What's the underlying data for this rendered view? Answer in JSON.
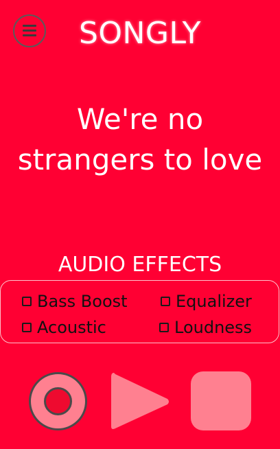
{
  "header": {
    "title": "SONGLY",
    "menu_icon": "hamburger-menu-icon"
  },
  "lyric": {
    "text": "We're no strangers to love"
  },
  "audio_effects": {
    "title": "AUDIO EFFECTS",
    "options": [
      {
        "label": "Bass Boost",
        "checked": false
      },
      {
        "label": "Equalizer",
        "checked": false
      },
      {
        "label": "Acoustic",
        "checked": false
      },
      {
        "label": "Loudness",
        "checked": false
      }
    ]
  },
  "controls": {
    "record_icon": "record-icon",
    "play_icon": "play-icon",
    "stop_icon": "stop-icon"
  },
  "colors": {
    "background": "#ff0033",
    "control_fill": "#ff8090",
    "record_dot": "#ee0a2f",
    "text_light": "#ffffff",
    "text_dark": "#111111"
  }
}
